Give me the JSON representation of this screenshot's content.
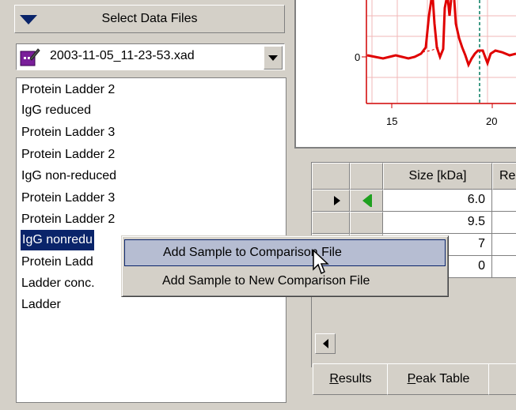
{
  "left_panel": {
    "header_label": "Select Data Files",
    "file_select": {
      "value": "2003-11-05_11-23-53.xad"
    },
    "samples": [
      {
        "label": "Protein Ladder 2",
        "selected": false
      },
      {
        "label": "IgG reduced",
        "selected": false
      },
      {
        "label": "Protein Ladder 3",
        "selected": false
      },
      {
        "label": "Protein Ladder 2",
        "selected": false
      },
      {
        "label": "IgG non-reduced",
        "selected": false
      },
      {
        "label": "Protein Ladder 3",
        "selected": false
      },
      {
        "label": "Protein Ladder 2",
        "selected": false
      },
      {
        "label": "IgG nonredu",
        "selected": true
      },
      {
        "label": "Protein Ladd",
        "selected": false
      },
      {
        "label": "Ladder conc.",
        "selected": false
      },
      {
        "label": "Ladder",
        "selected": false
      }
    ]
  },
  "plot": {
    "y_tick": "0",
    "x_ticks": [
      "15",
      "20"
    ],
    "line_color": "#e00000",
    "marker_color": "#007a5e"
  },
  "peak_grid": {
    "columns": [
      "Size [kDa]",
      "Re"
    ],
    "rows": [
      {
        "size": "6.0"
      },
      {
        "size": "9.5"
      },
      {
        "size": "7"
      },
      {
        "size": "0"
      }
    ]
  },
  "tabs": [
    {
      "label": "Results",
      "underline": "R",
      "rest": "esults"
    },
    {
      "label": "Peak Table",
      "underline": "P",
      "rest": "eak Table"
    }
  ],
  "context_menu": {
    "items": [
      {
        "label": "Add Sample to Comparison File",
        "highlighted": true
      },
      {
        "label": "Add Sample to New Comparison File",
        "highlighted": false
      }
    ]
  },
  "colors": {
    "selection": "#0a246a",
    "menu_highlight": "#b6bdd2",
    "face": "#d4d0c8"
  }
}
